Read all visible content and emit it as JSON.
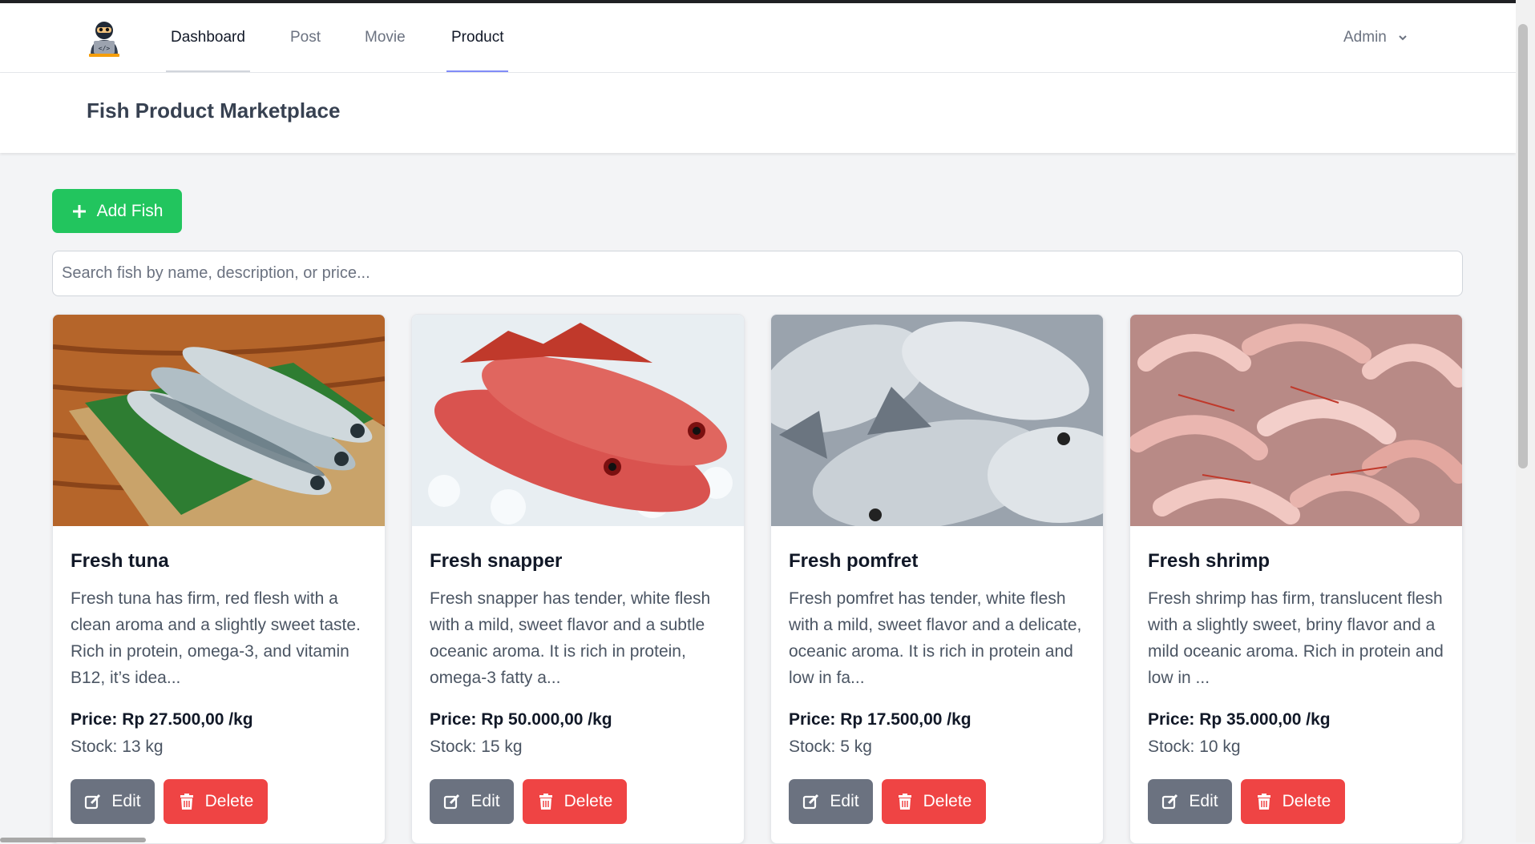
{
  "nav": {
    "links": [
      {
        "label": "Dashboard"
      },
      {
        "label": "Post"
      },
      {
        "label": "Movie"
      },
      {
        "label": "Product"
      }
    ],
    "user": "Admin"
  },
  "header": {
    "title": "Fish Product Marketplace"
  },
  "add_button": {
    "label": "Add Fish"
  },
  "search": {
    "placeholder": "Search fish by name, description, or price..."
  },
  "products": [
    {
      "name": "Fresh tuna",
      "description": "Fresh tuna has firm, red flesh with a clean aroma and a slightly sweet taste. Rich in protein, omega-3, and vitamin B12, it’s idea...",
      "price": "Price: Rp 27.500,00 /kg",
      "stock": "Stock: 13 kg",
      "edit_label": "Edit",
      "delete_label": "Delete"
    },
    {
      "name": "Fresh snapper",
      "description": "Fresh snapper has tender, white flesh with a mild, sweet flavor and a subtle oceanic aroma. It is rich in protein, omega-3 fatty a...",
      "price": "Price: Rp 50.000,00 /kg",
      "stock": "Stock: 15 kg",
      "edit_label": "Edit",
      "delete_label": "Delete"
    },
    {
      "name": "Fresh pomfret",
      "description": "Fresh pomfret has tender, white flesh with a mild, sweet flavor and a delicate, oceanic aroma. It is rich in protein and low in fa...",
      "price": "Price: Rp 17.500,00 /kg",
      "stock": "Stock: 5 kg",
      "edit_label": "Edit",
      "delete_label": "Delete"
    },
    {
      "name": "Fresh shrimp",
      "description": "Fresh shrimp has firm, translucent flesh with a slightly sweet, briny flavor and a mild oceanic aroma. Rich in protein and low in ...",
      "price": "Price: Rp 35.000,00 /kg",
      "stock": "Stock: 10 kg",
      "edit_label": "Edit",
      "delete_label": "Delete"
    }
  ],
  "colors": {
    "add_button": "#22c55e",
    "edit_button": "#6b7280",
    "delete_button": "#ef4444",
    "nav_active": "#818cf8"
  }
}
